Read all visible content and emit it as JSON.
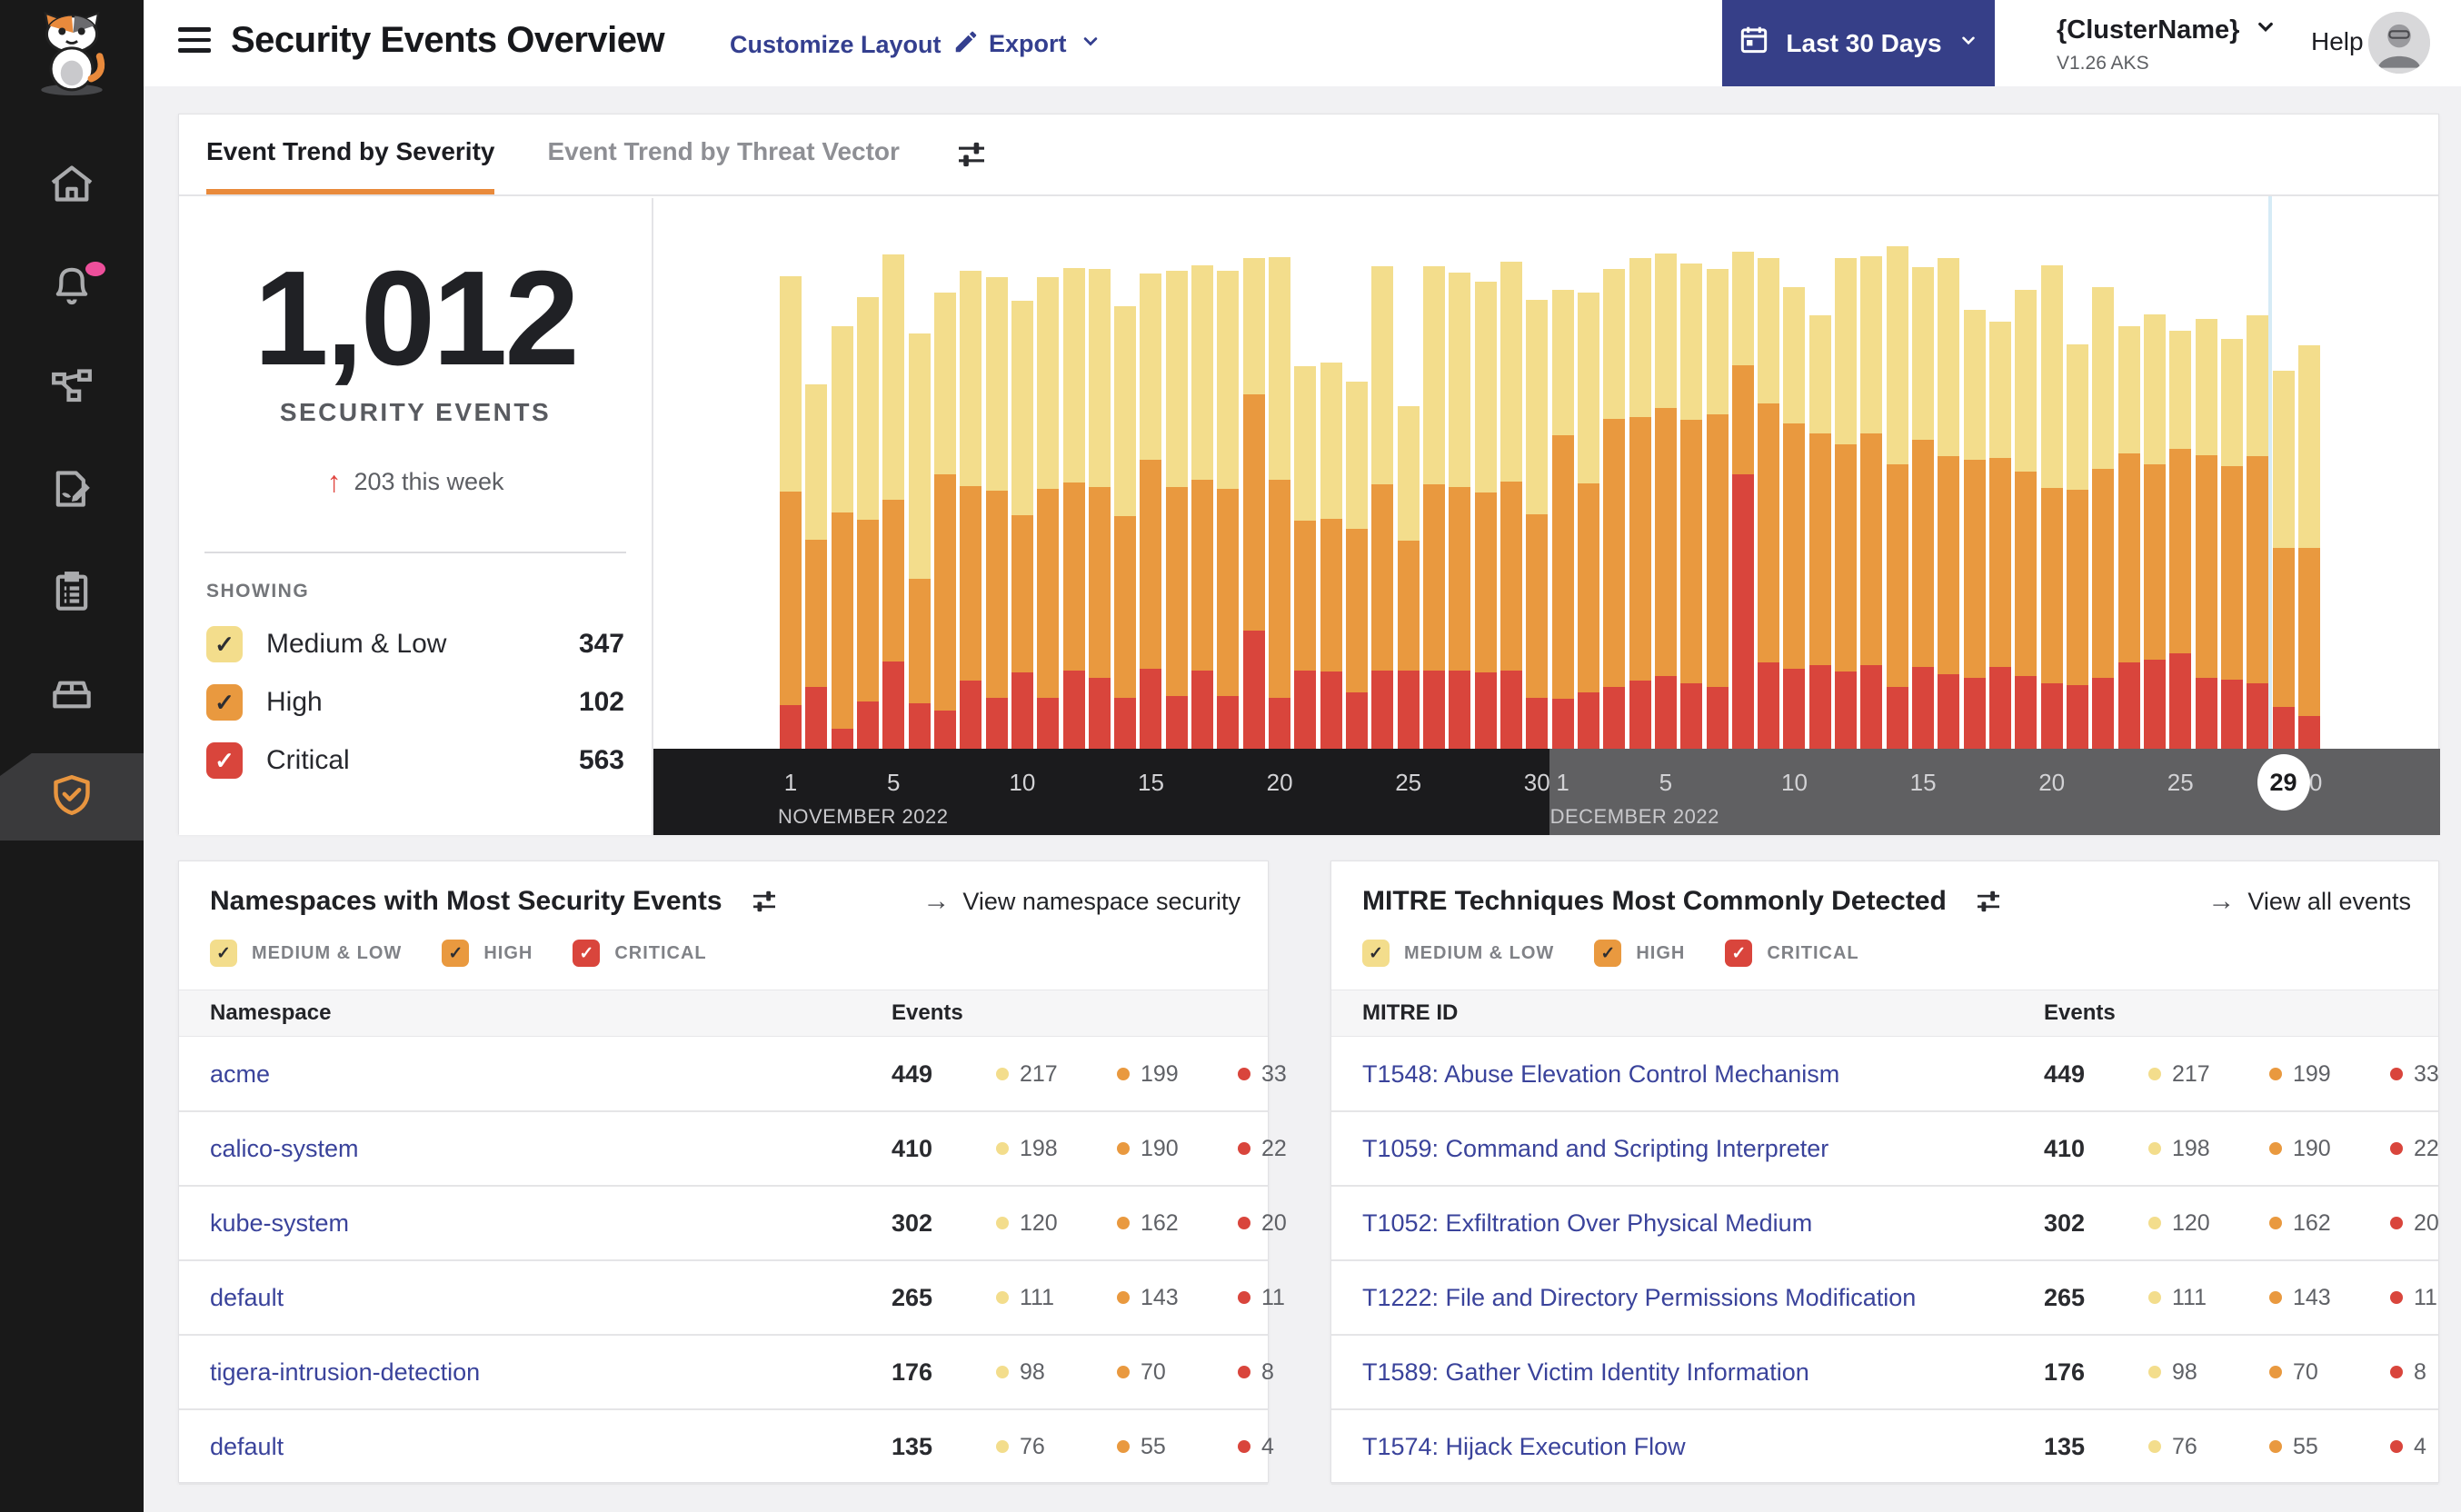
{
  "colors": {
    "medium_low": "#F3DD8C",
    "high": "#E9993F",
    "critical": "#D9453C",
    "accent_orange": "#E98A3B",
    "link_navy": "#3A439B",
    "button_navy": "#363F88",
    "notification_pink": "#ED4F9B",
    "now_marker_blue": "#D6EBF6",
    "axis_november_bg": "#1B1B1D",
    "axis_december_bg": "#606062"
  },
  "sidebar": {
    "logo": "calico-cat-logo",
    "items": [
      {
        "id": "home",
        "icon": "home-icon",
        "active": false,
        "badge": false
      },
      {
        "id": "alerts",
        "icon": "bell-icon",
        "active": false,
        "badge": true
      },
      {
        "id": "service-graph",
        "icon": "network-icon",
        "active": false,
        "badge": false
      },
      {
        "id": "policies",
        "icon": "document-edit-icon",
        "active": false,
        "badge": false
      },
      {
        "id": "compliance",
        "icon": "clipboard-icon",
        "active": false,
        "badge": false
      },
      {
        "id": "workloads",
        "icon": "storage-box-icon",
        "active": false,
        "badge": false
      },
      {
        "id": "threat-defense",
        "icon": "shield-check-icon",
        "active": true,
        "badge": false
      }
    ]
  },
  "header": {
    "title": "Security Events Overview",
    "customize_layout": "Customize Layout",
    "export_label": "Export",
    "date_range": "Last 30 Days",
    "cluster_name": "{ClusterName}",
    "cluster_version": "V1.26 AKS",
    "help": "Help"
  },
  "trend_card": {
    "tabs": [
      {
        "label": "Event Trend by Severity",
        "active": true
      },
      {
        "label": "Event Trend by Threat Vector",
        "active": false
      }
    ],
    "total": "1,012",
    "total_label": "SECURITY EVENTS",
    "delta_arrow": "↑",
    "delta": "203 this week",
    "showing_label": "SHOWING",
    "severities": [
      {
        "id": "medium-low",
        "label": "Medium & Low",
        "count": "347",
        "color": "#F3DD8C",
        "check": "#2d2e32"
      },
      {
        "id": "high",
        "label": "High",
        "count": "102",
        "color": "#E9993F",
        "check": "#2d2e32"
      },
      {
        "id": "critical",
        "label": "Critical",
        "count": "563",
        "color": "#D9453C",
        "check": "#ffffff"
      }
    ],
    "chart_data": {
      "type": "bar",
      "stacked": true,
      "title": "Event Trend by Severity",
      "xlabel": "day",
      "ylabel": "",
      "y_axis_shown": false,
      "units": "relative bar-segment heights estimated from pixels (no y-axis labels in source)",
      "ylim": [
        0,
        608
      ],
      "x_axis": {
        "months": [
          {
            "label": "NOVEMBER 2022",
            "days": 30,
            "ticks": [
              1,
              5,
              10,
              15,
              20,
              25,
              30
            ]
          },
          {
            "label": "DECEMBER 2022",
            "days": 30,
            "ticks": [
              1,
              5,
              10,
              15,
              20,
              25,
              30
            ],
            "current_day_marker": 29
          }
        ]
      },
      "series": [
        {
          "name": "Medium & Low",
          "color": "#F3DD8C",
          "values": [
            237,
            171,
            205,
            245,
            270,
            270,
            200,
            237,
            235,
            236,
            233,
            236,
            240,
            231,
            205,
            238,
            236,
            240,
            150,
            245,
            170,
            172,
            162,
            240,
            148,
            240,
            236,
            232,
            242,
            236,
            160,
            210,
            165,
            175,
            170,
            172,
            160,
            125,
            160,
            150,
            130,
            205,
            195,
            240,
            190,
            218,
            165,
            150,
            200,
            245,
            160,
            200,
            140,
            165,
            130,
            150,
            140,
            155,
            195,
            223
          ]
        },
        {
          "name": "High",
          "color": "#E9993F",
          "values": [
            235,
            162,
            238,
            200,
            178,
            137,
            260,
            214,
            228,
            173,
            230,
            207,
            210,
            200,
            230,
            230,
            210,
            228,
            260,
            240,
            165,
            168,
            180,
            205,
            143,
            205,
            202,
            198,
            208,
            202,
            290,
            230,
            295,
            290,
            295,
            290,
            300,
            120,
            285,
            270,
            255,
            250,
            255,
            245,
            250,
            240,
            240,
            230,
            225,
            215,
            215,
            230,
            230,
            215,
            225,
            245,
            235,
            250,
            175,
            185
          ]
        },
        {
          "name": "Critical",
          "color": "#D9453C",
          "values": [
            48,
            68,
            22,
            52,
            96,
            50,
            42,
            75,
            56,
            84,
            56,
            86,
            78,
            56,
            88,
            58,
            86,
            58,
            130,
            56,
            86,
            85,
            62,
            86,
            86,
            86,
            86,
            84,
            86,
            56,
            55,
            62,
            68,
            75,
            80,
            72,
            68,
            302,
            95,
            88,
            92,
            85,
            92,
            68,
            90,
            82,
            78,
            90,
            80,
            72,
            70,
            78,
            95,
            98,
            105,
            78,
            76,
            72,
            46,
            36
          ]
        }
      ]
    }
  },
  "namespaces_card": {
    "title": "Namespaces with Most Security Events",
    "link": "View namespace security",
    "link_arrow": "→",
    "filters": [
      {
        "label": "MEDIUM & LOW",
        "color": "#F3DD8C",
        "check": "#2d2e32"
      },
      {
        "label": "HIGH",
        "color": "#E9993F",
        "check": "#2d2e32"
      },
      {
        "label": "CRITICAL",
        "color": "#D9453C",
        "check": "#ffffff"
      }
    ],
    "columns": [
      "Namespace",
      "Events"
    ],
    "rows": [
      {
        "name": "acme",
        "total": "449",
        "medium_low": "217",
        "high": "199",
        "critical": "33"
      },
      {
        "name": "calico-system",
        "total": "410",
        "medium_low": "198",
        "high": "190",
        "critical": "22"
      },
      {
        "name": "kube-system",
        "total": "302",
        "medium_low": "120",
        "high": "162",
        "critical": "20"
      },
      {
        "name": "default",
        "total": "265",
        "medium_low": "111",
        "high": "143",
        "critical": "11"
      },
      {
        "name": "tigera-intrusion-detection",
        "total": "176",
        "medium_low": "98",
        "high": "70",
        "critical": "8"
      },
      {
        "name": "default",
        "total": "135",
        "medium_low": "76",
        "high": "55",
        "critical": "4"
      }
    ]
  },
  "mitre_card": {
    "title": "MITRE Techniques Most Commonly Detected",
    "link": "View all events",
    "link_arrow": "→",
    "filters": [
      {
        "label": "MEDIUM & LOW",
        "color": "#F3DD8C",
        "check": "#2d2e32"
      },
      {
        "label": "HIGH",
        "color": "#E9993F",
        "check": "#2d2e32"
      },
      {
        "label": "CRITICAL",
        "color": "#D9453C",
        "check": "#ffffff"
      }
    ],
    "columns": [
      "MITRE ID",
      "Events"
    ],
    "rows": [
      {
        "name": "T1548: Abuse Elevation Control Mechanism",
        "total": "449",
        "medium_low": "217",
        "high": "199",
        "critical": "33"
      },
      {
        "name": "T1059: Command and Scripting Interpreter",
        "total": "410",
        "medium_low": "198",
        "high": "190",
        "critical": "22"
      },
      {
        "name": "T1052: Exfiltration Over Physical Medium",
        "total": "302",
        "medium_low": "120",
        "high": "162",
        "critical": "20"
      },
      {
        "name": "T1222: File and Directory Permissions Modification",
        "total": "265",
        "medium_low": "111",
        "high": "143",
        "critical": "11"
      },
      {
        "name": "T1589: Gather Victim Identity Information",
        "total": "176",
        "medium_low": "98",
        "high": "70",
        "critical": "8"
      },
      {
        "name": "T1574: Hijack Execution Flow",
        "total": "135",
        "medium_low": "76",
        "high": "55",
        "critical": "4"
      }
    ]
  }
}
